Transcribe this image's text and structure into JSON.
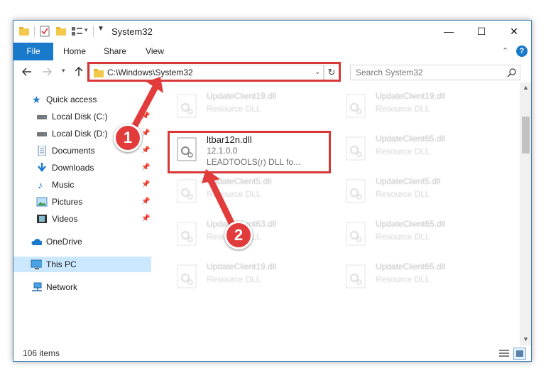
{
  "window": {
    "title": "System32",
    "controls": {
      "minimize": "—",
      "maximize": "☐",
      "close": "✕"
    }
  },
  "ribbon": {
    "tabs": [
      {
        "label": "File"
      },
      {
        "label": "Home"
      },
      {
        "label": "Share"
      },
      {
        "label": "View"
      }
    ],
    "help": "?",
    "collapse": "⌃"
  },
  "address_bar": {
    "path": "C:\\Windows\\System32",
    "search_placeholder": "Search System32"
  },
  "nav_pane": {
    "items": [
      {
        "label": "Quick access",
        "icon": "star-icon"
      },
      {
        "label": "Local Disk (C:)",
        "icon": "drive-icon"
      },
      {
        "label": "Local Disk (D:)",
        "icon": "drive-icon"
      },
      {
        "label": "Documents",
        "icon": "documents-icon"
      },
      {
        "label": "Downloads",
        "icon": "download-icon"
      },
      {
        "label": "Music",
        "icon": "music-icon"
      },
      {
        "label": "Pictures",
        "icon": "pictures-icon"
      },
      {
        "label": "Videos",
        "icon": "videos-icon"
      },
      {
        "label": "OneDrive",
        "icon": "cloud-icon"
      },
      {
        "label": "This PC",
        "icon": "computer-icon"
      },
      {
        "label": "Network",
        "icon": "network-icon"
      }
    ]
  },
  "files": {
    "left_column": [
      {
        "name": "UpdateClient19.dll",
        "desc": "Resource DLL"
      },
      {
        "name": "ltbar12n.dll",
        "desc": "12.1.0.0",
        "desc2": "LEADTOOLS(r) DLL fo..."
      },
      {
        "name": "UpdateClient5.dll",
        "desc": "Resource DLL"
      },
      {
        "name": "UpdateClient63.dll",
        "desc": "Resource DLL"
      },
      {
        "name": "UpdateClient19.dll",
        "desc": "Resource DLL"
      }
    ],
    "right_column": [
      {
        "name": "UpdateClient19.dll",
        "desc": "Resource DLL"
      },
      {
        "name": "UpdateClient65.dll",
        "desc": "Resource DLL"
      },
      {
        "name": "UpdateClient5.dll",
        "desc": "Resource DLL"
      },
      {
        "name": "UpdateClient65.dll",
        "desc": "Resource DLL"
      },
      {
        "name": "UpdateClient65.dll",
        "desc": "Resource DLL"
      }
    ]
  },
  "status": {
    "items_count": "106 items"
  },
  "callouts": {
    "one": "1",
    "two": "2"
  },
  "colors": {
    "accent": "#1979ca",
    "callout": "#e23b3b",
    "selection": "#cce8ff"
  }
}
